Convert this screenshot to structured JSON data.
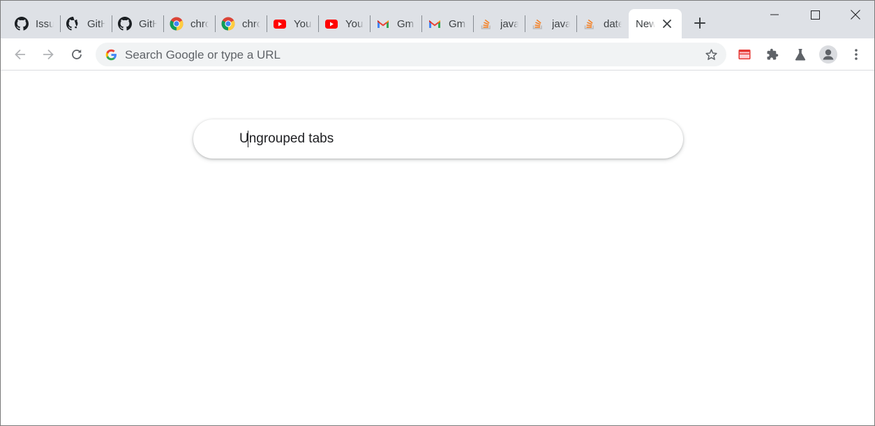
{
  "tabs": [
    {
      "title": "Issu",
      "icon": "github-icon"
    },
    {
      "title": "GitH",
      "icon": "github-icon"
    },
    {
      "title": "GitH",
      "icon": "github-icon"
    },
    {
      "title": "chro",
      "icon": "chrome-icon"
    },
    {
      "title": "chro",
      "icon": "chrome-icon"
    },
    {
      "title": "You",
      "icon": "youtube-icon"
    },
    {
      "title": "You",
      "icon": "youtube-icon"
    },
    {
      "title": "Gm",
      "icon": "gmail-icon"
    },
    {
      "title": "Gm",
      "icon": "gmail-icon"
    },
    {
      "title": "java",
      "icon": "stackoverflow-icon"
    },
    {
      "title": "java",
      "icon": "stackoverflow-icon"
    },
    {
      "title": "date",
      "icon": "stackoverflow-icon"
    }
  ],
  "active_tab": {
    "title": "New",
    "icon": "close-icon"
  },
  "omnibox": {
    "placeholder": "Search Google or type a URL"
  },
  "tab_search": {
    "value": "Ungrouped tabs"
  },
  "colors": {
    "tabstrip_bg": "#dee1e6",
    "omnibox_bg": "#f1f3f4",
    "youtube_red": "#ff0000",
    "stackoverflow_orange": "#f48024",
    "github_black": "#1b1f23"
  }
}
